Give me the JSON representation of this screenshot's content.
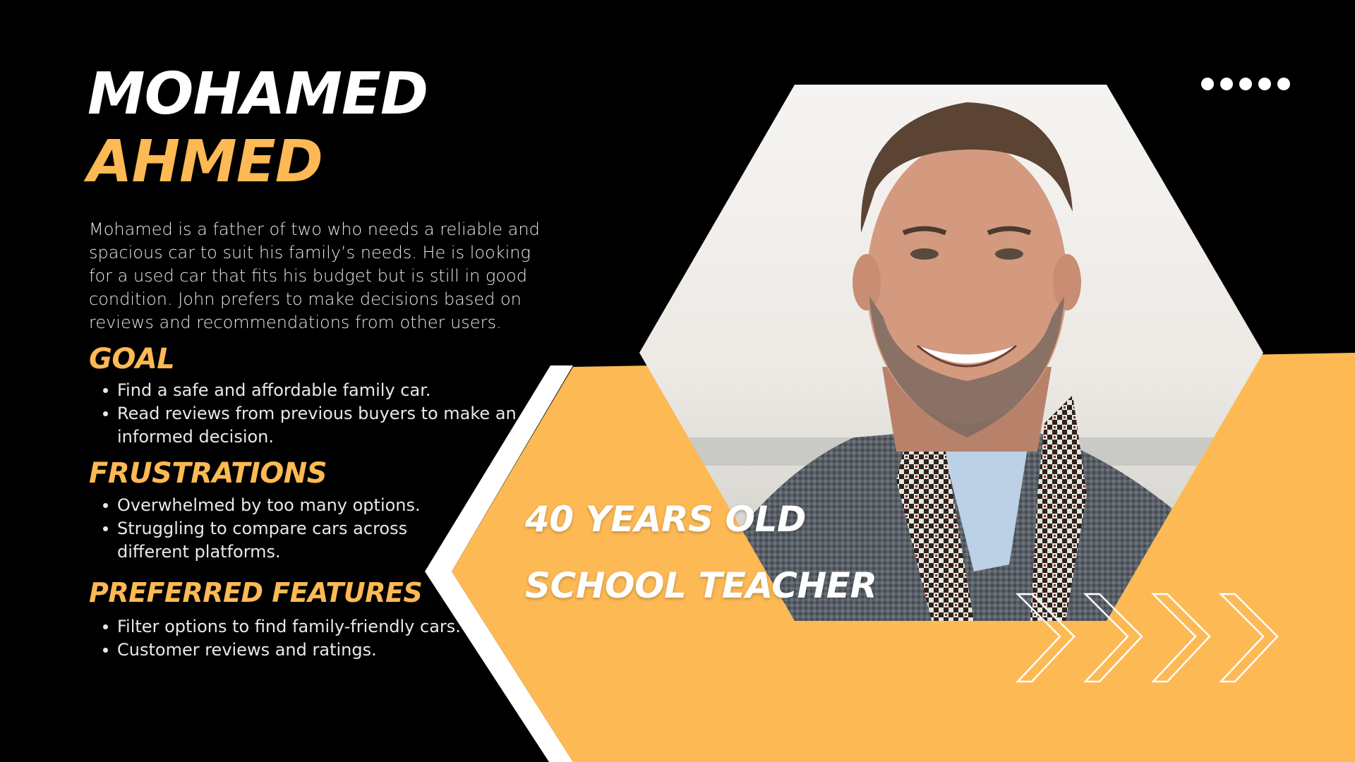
{
  "colors": {
    "background": "#000000",
    "accent": "#FDB954",
    "text_primary": "#FFFFFF",
    "text_body": "#E8E8E8"
  },
  "persona": {
    "first_name": "MOHAMED",
    "last_name": "AHMED",
    "bio": "Mohamed is a father of two who needs a reliable and spacious car to suit his family’s needs. He is looking for a used car that fits his budget but is still in good condition. John prefers to make decisions based on reviews and recommendations from other users.",
    "age": "40 YEARS OLD",
    "occupation": "SCHOOL TEACHER",
    "photo_description": "smiling bearded man in grey tweed coat and houndstooth scarf"
  },
  "sections": {
    "goal": {
      "heading": "GOAL",
      "items": [
        "Find a safe and affordable family car.",
        "Read reviews from previous buyers to make an informed decision."
      ]
    },
    "frustrations": {
      "heading": "FRUSTRATIONS",
      "items": [
        "Overwhelmed by too many options.",
        "Struggling to compare cars across different platforms."
      ]
    },
    "preferred_features": {
      "heading": "PREFERRED FEATURES",
      "items": [
        "Filter options to find family-friendly cars.",
        "Customer reviews and ratings."
      ]
    }
  },
  "decorations": {
    "dots_icon": "five-dots-icon",
    "chevrons_icon": "chevron-right-row-icon"
  }
}
